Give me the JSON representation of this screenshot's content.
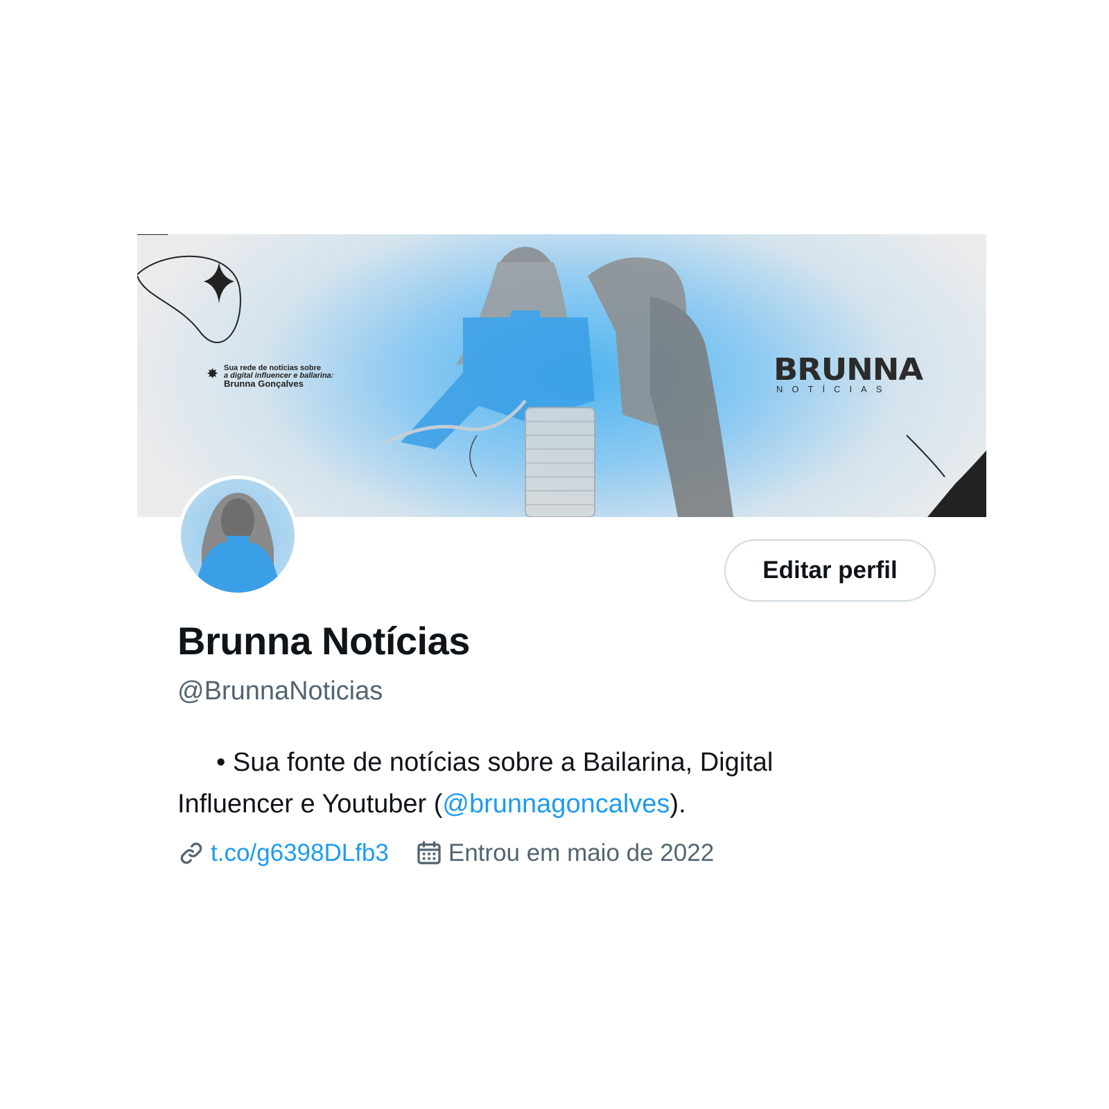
{
  "banner": {
    "tagline_line1": "Sua rede de notícias sobre",
    "tagline_line2": "a digital influencer e ballarina:",
    "tagline_line3": "Brunna Gonçalves",
    "logo_main": "BRUNNA",
    "logo_sub": "NOTÍCIAS",
    "accent_color": "#4fb4ef"
  },
  "profile": {
    "display_name": "Brunna Notícias",
    "handle": "@BrunnaNoticias",
    "edit_button_label": "Editar perfil",
    "bio_text": "• Sua fonte de notícias sobre a Bailarina, Digital Influencer e Youtuber (",
    "bio_mention": "@brunnagoncalves",
    "bio_end": ").",
    "website": "t.co/g6398DLfb3",
    "joined": "Entrou em maio de 2022",
    "link_icon": "link-icon",
    "calendar_icon": "calendar-icon",
    "link_color": "#1d9bf0",
    "secondary_color": "#536471"
  }
}
